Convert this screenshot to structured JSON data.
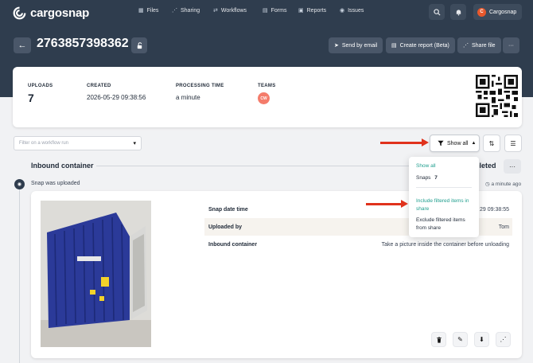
{
  "brand": {
    "name": "cargosnap"
  },
  "nav": [
    {
      "label": "Files",
      "icon": "files-icon",
      "glyph": "▦"
    },
    {
      "label": "Sharing",
      "icon": "share-icon",
      "glyph": "⋰"
    },
    {
      "label": "Workflows",
      "icon": "workflow-icon",
      "glyph": "⇄"
    },
    {
      "label": "Forms",
      "icon": "forms-icon",
      "glyph": "▤"
    },
    {
      "label": "Reports",
      "icon": "reports-icon",
      "glyph": "▣"
    },
    {
      "label": "Issues",
      "icon": "issues-icon",
      "glyph": "◉"
    }
  ],
  "user": {
    "initial": "C",
    "name": "Cargosnap"
  },
  "file": {
    "title": "2763857398362"
  },
  "actions": {
    "send_email": "Send by email",
    "create_report": "Create report (Beta)",
    "share_file": "Share file"
  },
  "info": {
    "uploads_label": "UPLOADS",
    "uploads_value": "7",
    "created_label": "CREATED",
    "created_value": "2026-05-29 09:38:56",
    "processing_label": "PROCESSING TIME",
    "processing_value": "a minute",
    "teams_label": "TEAMS",
    "team_badge": "CW"
  },
  "filter": {
    "placeholder": "Filter on a workflow run"
  },
  "show_all": {
    "label": "Show all"
  },
  "dropdown": {
    "show_all": "Show all",
    "snaps_label": "Snaps",
    "snaps_count": "7",
    "include_line1": "Include filtered items in",
    "include_line2": "share",
    "exclude_line1": "Exclude filtered items",
    "exclude_line2": "from share"
  },
  "section": {
    "title": "Inbound container",
    "status_partial": "pleted"
  },
  "event": {
    "text": "Snap was uploaded",
    "time": "a minute ago"
  },
  "snap": {
    "rows": [
      {
        "key": "Snap date time",
        "value": "29 09:38:55"
      },
      {
        "key": "Uploaded by",
        "value": "Tom"
      },
      {
        "key": "Inbound container",
        "value": "Take a picture inside the container before unloading"
      }
    ]
  },
  "colors": {
    "header_bg": "#2f3d4e",
    "accent_green": "#1f9e8e",
    "arrow_red": "#e0321c",
    "team_badge": "#f47c6b",
    "user_badge": "#e8582c"
  }
}
